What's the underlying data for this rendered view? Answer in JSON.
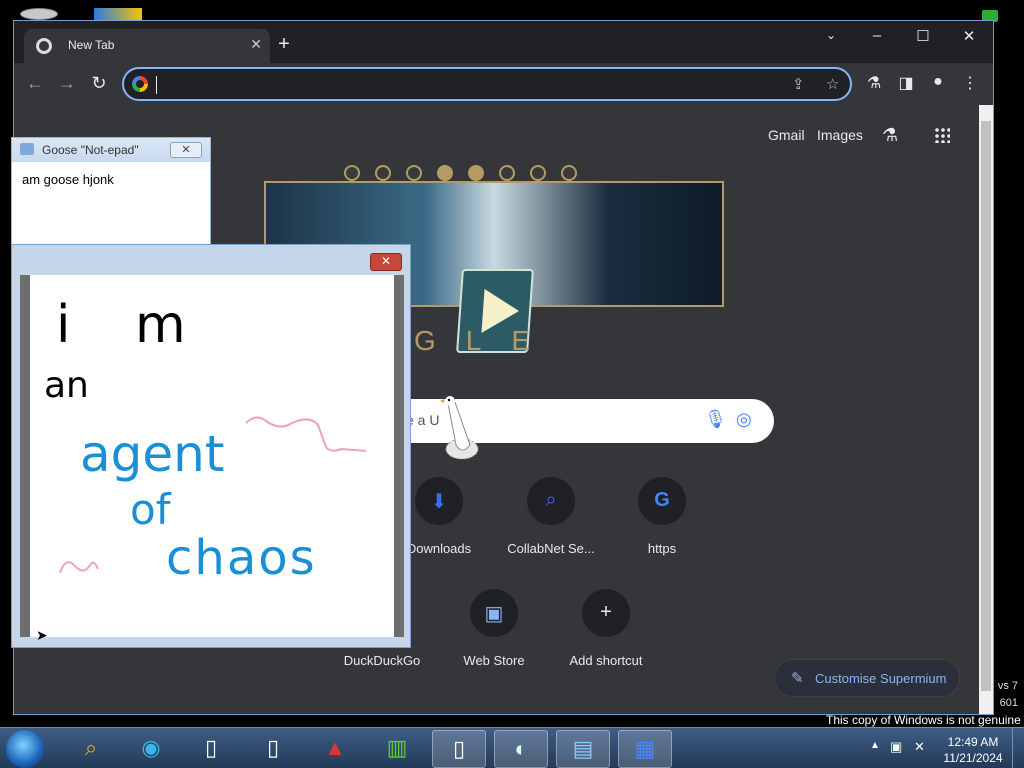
{
  "desktop": {
    "side_text_1": "vs 7",
    "side_text_2": "601",
    "genuine_notice": "This copy of Windows is not genuine"
  },
  "browser": {
    "tab_title": "New Tab",
    "address_value": "",
    "top_links": {
      "gmail": "Gmail",
      "images": "Images"
    },
    "doodle_letters": "GLE",
    "search_placeholder_fragment": "e a U",
    "shortcuts_row1": [
      {
        "label": "Downloads",
        "icon": "download-bird-icon"
      },
      {
        "label": "CollabNet Se...",
        "icon": "search-magnifier-icon"
      },
      {
        "label": "https",
        "icon": "google-g-icon"
      }
    ],
    "shortcuts_row2": [
      {
        "label": "DuckDuckGo",
        "icon": "duckduckgo-icon"
      },
      {
        "label": "Web Store",
        "icon": "web-store-icon"
      },
      {
        "label": "Add shortcut",
        "icon": "plus-icon"
      }
    ],
    "customise_label": "Customise Supermium"
  },
  "notepad": {
    "title": "Goose \"Not-epad\"",
    "text": "am goose hjonk"
  },
  "paint_drawing": {
    "line1": "i m",
    "line2": "an",
    "line3": "agent",
    "line4": "of",
    "line5": "chaos"
  },
  "taskbar": {
    "time": "12:49 AM",
    "date": "11/21/2024"
  },
  "colors": {
    "accent": "#8ab4f8",
    "ink_black": "#000000",
    "ink_blue": "#1b8fd6",
    "ink_pink": "#f0a3b0"
  }
}
